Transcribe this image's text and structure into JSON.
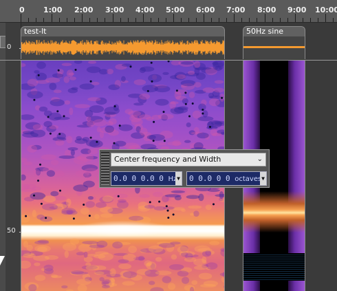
{
  "ruler": {
    "ticks": [
      "0",
      "1:00",
      "2:00",
      "3:00",
      "4:00",
      "5:00",
      "6:00",
      "7:00",
      "8:00",
      "9:00",
      "10:00"
    ]
  },
  "vertical_scale": {
    "top_label": "0",
    "mid_label": "50"
  },
  "tracks": [
    {
      "name": "test-lt"
    },
    {
      "name": "50Hz sine"
    }
  ],
  "dialog": {
    "mode_select": "Center frequency and Width",
    "center_freq_value": "0.0 0 0.0 0",
    "center_freq_unit": "Hz",
    "width_value": "0 0.0 0 0",
    "width_unit": "octaves"
  },
  "colors": {
    "waveform": "#f59a30",
    "spectrogram_low": "#6a3fbf",
    "spectrogram_high": "#ffffff",
    "dialog_number_bg": "#1d2a66"
  }
}
